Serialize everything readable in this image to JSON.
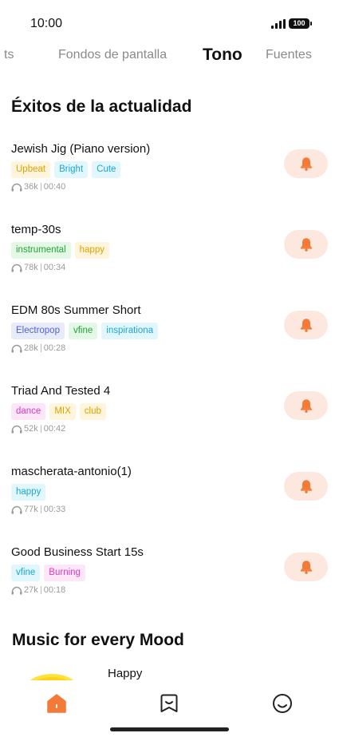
{
  "status": {
    "time": "10:00",
    "battery": "100"
  },
  "tabs": [
    {
      "label": "ts"
    },
    {
      "label": "Fondos de pantalla"
    },
    {
      "label": "Tono"
    },
    {
      "label": "Fuentes"
    }
  ],
  "section1_title": "Éxitos de la actualidad",
  "songs": [
    {
      "title": "Jewish Jig (Piano version)",
      "tags": [
        "Upbeat",
        "Bright",
        "Cute"
      ],
      "plays": "36k",
      "duration": "00:40"
    },
    {
      "title": "temp-30s",
      "tags": [
        "instrumental",
        "happy"
      ],
      "plays": "78k",
      "duration": "00:34"
    },
    {
      "title": "EDM 80s Summer Short",
      "tags": [
        "Electropop",
        "vfine",
        "inspirationa"
      ],
      "plays": "28k",
      "duration": "00:28"
    },
    {
      "title": "Triad And Tested 4",
      "tags": [
        "dance",
        "MIX",
        "club"
      ],
      "plays": "52k",
      "duration": "00:42"
    },
    {
      "title": "mascherata-antonio(1)",
      "tags": [
        "happy"
      ],
      "plays": "77k",
      "duration": "00:33"
    },
    {
      "title": "Good Business Start 15s",
      "tags": [
        "vfine",
        "Burning"
      ],
      "plays": "27k",
      "duration": "00:18"
    }
  ],
  "section2_title": "Music for every Mood",
  "mood_item": {
    "label": "Happy"
  },
  "colors": {
    "accent": "#f47a38",
    "bell_bg": "#fde8df"
  }
}
